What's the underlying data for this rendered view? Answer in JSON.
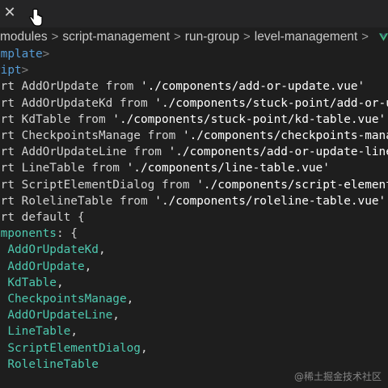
{
  "breadcrumb": {
    "items": [
      "modules",
      "script-management",
      "run-group",
      "level-management"
    ],
    "separator": ">",
    "file_icon": "vue-logo-icon"
  },
  "code": {
    "lines": [
      {
        "tokens": [
          {
            "t": "emplate",
            "c": "tag"
          },
          {
            "t": ">",
            "c": "punct"
          }
        ]
      },
      {
        "tokens": [
          {
            "t": "ript",
            "c": "tag"
          },
          {
            "t": ">",
            "c": "punct"
          }
        ]
      },
      {
        "tokens": [
          {
            "t": "ort ",
            "c": "kw"
          },
          {
            "t": "AddOrUpdate",
            "c": "id"
          },
          {
            "t": " from ",
            "c": "kw"
          },
          {
            "t": "'./components/add-or-update.vue'",
            "c": "str"
          }
        ]
      },
      {
        "tokens": [
          {
            "t": "ort ",
            "c": "kw"
          },
          {
            "t": "AddOrUpdateKd",
            "c": "id"
          },
          {
            "t": " from ",
            "c": "kw"
          },
          {
            "t": "'./components/stuck-point/add-or-upda",
            "c": "str"
          }
        ]
      },
      {
        "tokens": [
          {
            "t": "ort ",
            "c": "kw"
          },
          {
            "t": "KdTable",
            "c": "id"
          },
          {
            "t": " from ",
            "c": "kw"
          },
          {
            "t": "'./components/stuck-point/kd-table.vue'",
            "c": "str"
          }
        ]
      },
      {
        "tokens": [
          {
            "t": "ort ",
            "c": "kw"
          },
          {
            "t": "CheckpointsManage",
            "c": "id"
          },
          {
            "t": " from ",
            "c": "kw"
          },
          {
            "t": "'./components/checkpoints-manage.",
            "c": "str"
          }
        ]
      },
      {
        "tokens": [
          {
            "t": "ort ",
            "c": "kw"
          },
          {
            "t": "AddOrUpdateLine",
            "c": "id"
          },
          {
            "t": " from ",
            "c": "kw"
          },
          {
            "t": "'./components/add-or-update-line.vu",
            "c": "str"
          }
        ]
      },
      {
        "tokens": [
          {
            "t": "ort ",
            "c": "kw"
          },
          {
            "t": "LineTable",
            "c": "id"
          },
          {
            "t": " from ",
            "c": "kw"
          },
          {
            "t": "'./components/line-table.vue'",
            "c": "str"
          }
        ]
      },
      {
        "tokens": [
          {
            "t": "ort ",
            "c": "kw"
          },
          {
            "t": "ScriptElementDialog",
            "c": "id"
          },
          {
            "t": " from ",
            "c": "kw"
          },
          {
            "t": "'./components/script-element-di",
            "c": "str"
          }
        ]
      },
      {
        "tokens": [
          {
            "t": "ort ",
            "c": "kw"
          },
          {
            "t": "RolelineTable",
            "c": "id"
          },
          {
            "t": " from ",
            "c": "kw"
          },
          {
            "t": "'./components/roleline-table.vue'",
            "c": "str"
          }
        ]
      },
      {
        "tokens": [
          {
            "t": "ort default {",
            "c": "kw"
          }
        ]
      },
      {
        "tokens": [
          {
            "t": "omponents",
            "c": "prop"
          },
          {
            "t": ": {",
            "c": "kw"
          }
        ]
      },
      {
        "tokens": [
          {
            "t": "  AddOrUpdateKd",
            "c": "comp"
          },
          {
            "t": ",",
            "c": "kw"
          }
        ]
      },
      {
        "tokens": [
          {
            "t": "  AddOrUpdate",
            "c": "comp"
          },
          {
            "t": ",",
            "c": "kw"
          }
        ]
      },
      {
        "tokens": [
          {
            "t": "  KdTable",
            "c": "comp"
          },
          {
            "t": ",",
            "c": "kw"
          }
        ]
      },
      {
        "tokens": [
          {
            "t": "  CheckpointsManage",
            "c": "comp"
          },
          {
            "t": ",",
            "c": "kw"
          }
        ]
      },
      {
        "tokens": [
          {
            "t": "  AddOrUpdateLine",
            "c": "comp"
          },
          {
            "t": ",",
            "c": "kw"
          }
        ]
      },
      {
        "tokens": [
          {
            "t": "  LineTable",
            "c": "comp"
          },
          {
            "t": ",",
            "c": "kw"
          }
        ]
      },
      {
        "tokens": [
          {
            "t": "  ScriptElementDialog",
            "c": "comp"
          },
          {
            "t": ",",
            "c": "kw"
          }
        ]
      },
      {
        "tokens": [
          {
            "t": "  RolelineTable",
            "c": "comp"
          }
        ]
      },
      {
        "tokens": [
          {
            "t": ",",
            "c": "kw"
          }
        ]
      }
    ]
  },
  "watermark": "@稀土掘金技术社区",
  "colors": {
    "background": "#1e1e1e",
    "tag": "#569cd6",
    "string": "#ffffff",
    "property": "#4ec9b0",
    "vue_green": "#41b883"
  },
  "icons": {
    "tab_close": "close-icon",
    "pointer": "hand-cursor-icon"
  }
}
